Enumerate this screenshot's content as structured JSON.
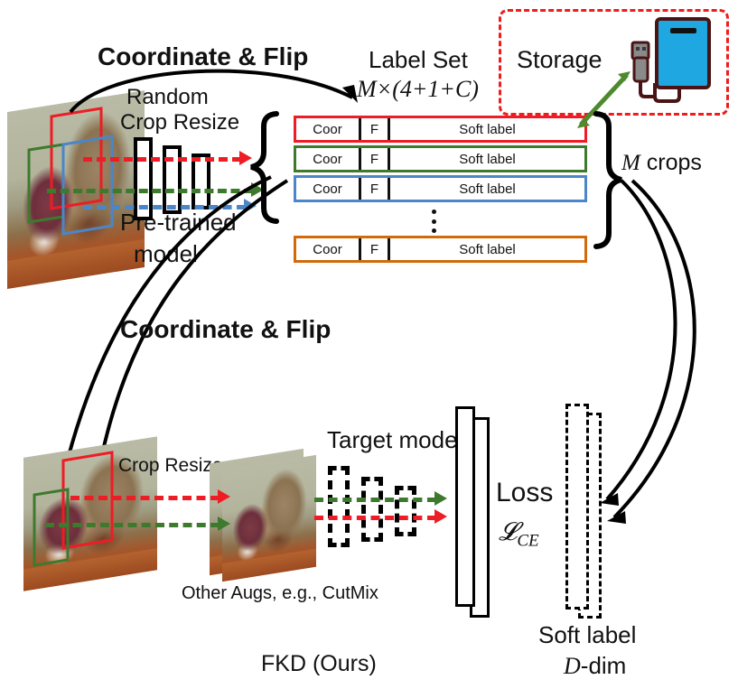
{
  "figure": {
    "caption": "FKD (Ours)",
    "top_flow_label": "Coordinate & Flip",
    "bottom_flow_label": "Coordinate & Flip"
  },
  "top": {
    "random_crop_line1": "Random",
    "random_crop_line2": "Crop Resize",
    "pretrained_line1": "Pre-trained",
    "pretrained_line2": "model",
    "label_set_title": "Label Set",
    "label_set_dims": "M×(4+1+C)",
    "m_crops": "M crops"
  },
  "label_set": {
    "columns": [
      "Coor",
      "F",
      "Soft label"
    ],
    "rows": [
      {
        "color": "#ee1c25",
        "coor": "Coor",
        "flip": "F",
        "soft": "Soft label"
      },
      {
        "color": "#3e7a2e",
        "coor": "Coor",
        "flip": "F",
        "soft": "Soft label"
      },
      {
        "color": "#4a86c8",
        "coor": "Coor",
        "flip": "F",
        "soft": "Soft label"
      },
      {
        "color": "#d2690a",
        "coor": "Coor",
        "flip": "F",
        "soft": "Soft label"
      }
    ],
    "ellipsis": "⋮"
  },
  "storage": {
    "label": "Storage",
    "icon": "external-hard-drive-usb",
    "border_color": "#ef1c1c",
    "drive_color": "#1ea7e0",
    "arrow_color": "#4e8a2d"
  },
  "bottom": {
    "crop_resize": "Crop Resize",
    "other_augs": "Other Augs, e.g., CutMix",
    "target_model": "Target model",
    "loss_title": "Loss",
    "loss_symbol": "𝓛",
    "loss_sub": "CE",
    "soft_label_line1": "Soft label",
    "soft_label_dim": "D-dim"
  },
  "colors": {
    "red": "#ee1c25",
    "green": "#3e7a2e",
    "blue": "#4a86c8",
    "orange": "#d2690a",
    "storage_red": "#ef1c1c",
    "drive_blue": "#1ea7e0",
    "arrow_green": "#4e8a2d",
    "black": "#000000"
  }
}
